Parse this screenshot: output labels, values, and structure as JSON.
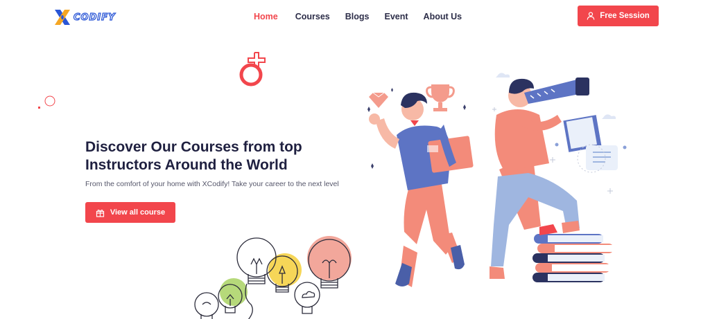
{
  "brand": {
    "name": "CODIFY",
    "accent": "#f2464c",
    "logo_blue": "#2a56d6",
    "logo_orange": "#f5a623"
  },
  "nav": {
    "items": [
      {
        "label": "Home",
        "active": true
      },
      {
        "label": "Courses",
        "active": false
      },
      {
        "label": "Blogs",
        "active": false
      },
      {
        "label": "Event",
        "active": false
      },
      {
        "label": "About Us",
        "active": false
      }
    ]
  },
  "header": {
    "cta_label": "Free Session",
    "cta_icon": "user-icon"
  },
  "hero": {
    "title": "Discover Our Courses from top Instructors Around the World",
    "subtitle": "From the comfort of your home with XCodify! Take your career to the next level",
    "button_label": "View all course",
    "button_icon": "gift-box-icon"
  }
}
